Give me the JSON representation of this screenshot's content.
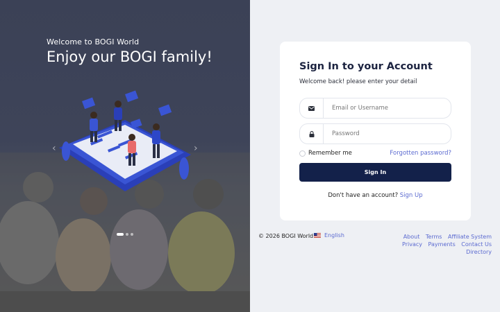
{
  "hero": {
    "eyebrow": "Welcome to BOGI World",
    "headline": "Enjoy our BOGI family!",
    "prev_icon": "chevron-left-icon",
    "next_icon": "chevron-right-icon",
    "slides": {
      "count": 3,
      "active": 1
    }
  },
  "card": {
    "title": "Sign In to your Account",
    "subtitle": "Welcome back! please enter your detail",
    "email": {
      "placeholder": "Email or Username",
      "icon": "envelope-icon"
    },
    "password": {
      "placeholder": "Password",
      "icon": "lock-icon"
    },
    "remember_label": "Remember me",
    "forgot_label": "Forgotten password?",
    "signin_label": "Sign In",
    "signup_prompt": "Don't have an account?",
    "signup_link": "Sign Up"
  },
  "footer": {
    "copyright": "© 2026 BOGI World",
    "language": "English",
    "links": [
      "About",
      "Terms",
      "Affiliate System",
      "Privacy",
      "Payments",
      "Contact Us",
      "Directory"
    ]
  },
  "colors": {
    "accent": "#5b6ad0",
    "button": "#13214a",
    "illustration_blue": "#3a55d4"
  }
}
